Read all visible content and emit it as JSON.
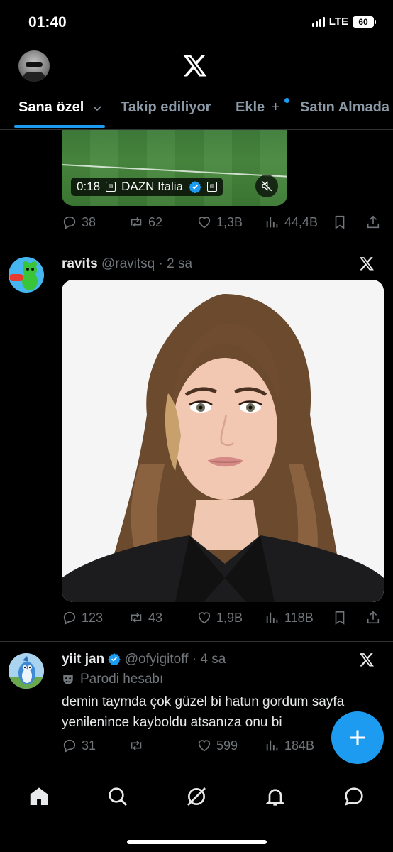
{
  "status": {
    "time": "01:40",
    "network": "LTE",
    "battery": "60"
  },
  "tabs": [
    {
      "label": "Sana özel",
      "active": true
    },
    {
      "label": "Takip ediliyor"
    },
    {
      "label": "Ekle"
    },
    {
      "label": "Satın Almada"
    }
  ],
  "video_tweet": {
    "duration": "0:18",
    "source": "DAZN Italia",
    "stats": {
      "replies": "38",
      "reposts": "62",
      "likes": "1,3B",
      "views": "44,4B"
    }
  },
  "tweet1": {
    "name": "ravits",
    "handle": "@ravitsq",
    "time": "2 sa",
    "stats": {
      "replies": "123",
      "reposts": "43",
      "likes": "1,9B",
      "views": "118B"
    }
  },
  "tweet2": {
    "name": "yiit jan",
    "handle": "@ofyigitoff",
    "time": "4 sa",
    "parody_label": "Parodi hesabı",
    "text": "demin taymda çok güzel bi hatun gordum sayfa yenilenince kayboldu atsanıza onu bi",
    "stats": {
      "replies": "31",
      "reposts": "",
      "likes": "599",
      "views": "184B"
    }
  },
  "colors": {
    "accent": "#1d9bf0",
    "background": "#000000",
    "muted": "#71767b"
  },
  "icons": [
    "home-icon",
    "search-icon",
    "grok-icon",
    "notifications-icon",
    "messages-icon"
  ]
}
